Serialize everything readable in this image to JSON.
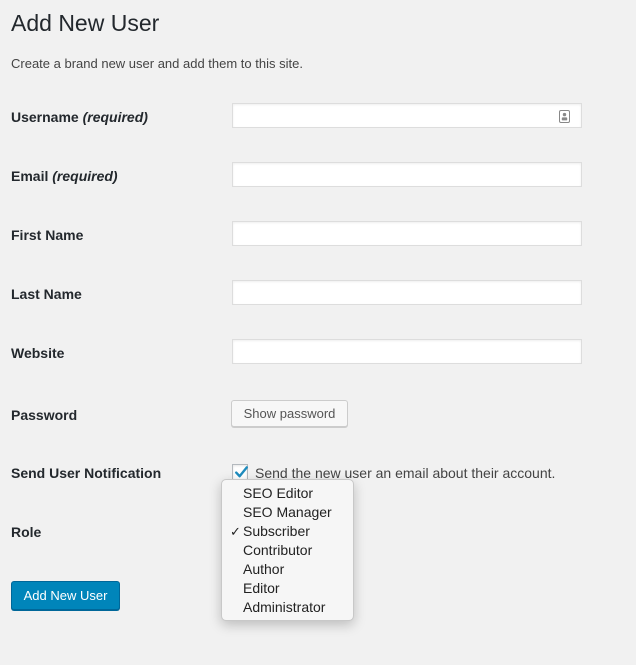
{
  "page": {
    "title": "Add New User",
    "intro": "Create a brand new user and add them to this site."
  },
  "form": {
    "username": {
      "label": "Username",
      "required": "(required)",
      "value": ""
    },
    "email": {
      "label": "Email",
      "required": "(required)",
      "value": ""
    },
    "first_name": {
      "label": "First Name",
      "value": ""
    },
    "last_name": {
      "label": "Last Name",
      "value": ""
    },
    "website": {
      "label": "Website",
      "value": ""
    },
    "password": {
      "label": "Password",
      "button": "Show password"
    },
    "notification": {
      "label": "Send User Notification",
      "checkbox_text": "Send the new user an email about their account.",
      "checked": true
    },
    "role": {
      "label": "Role",
      "options": [
        {
          "label": "SEO Editor",
          "selected": false
        },
        {
          "label": "SEO Manager",
          "selected": false
        },
        {
          "label": "Subscriber",
          "selected": true
        },
        {
          "label": "Contributor",
          "selected": false
        },
        {
          "label": "Author",
          "selected": false
        },
        {
          "label": "Editor",
          "selected": false
        },
        {
          "label": "Administrator",
          "selected": false
        }
      ]
    },
    "submit": "Add New User"
  },
  "colors": {
    "primary": "#0085ba",
    "checkmark": "#1e8cbe",
    "background": "#f1f1f1"
  },
  "icons": {
    "username_field": "contact-card-icon",
    "checkbox": "checkmark-icon",
    "selected_option": "check-icon"
  }
}
